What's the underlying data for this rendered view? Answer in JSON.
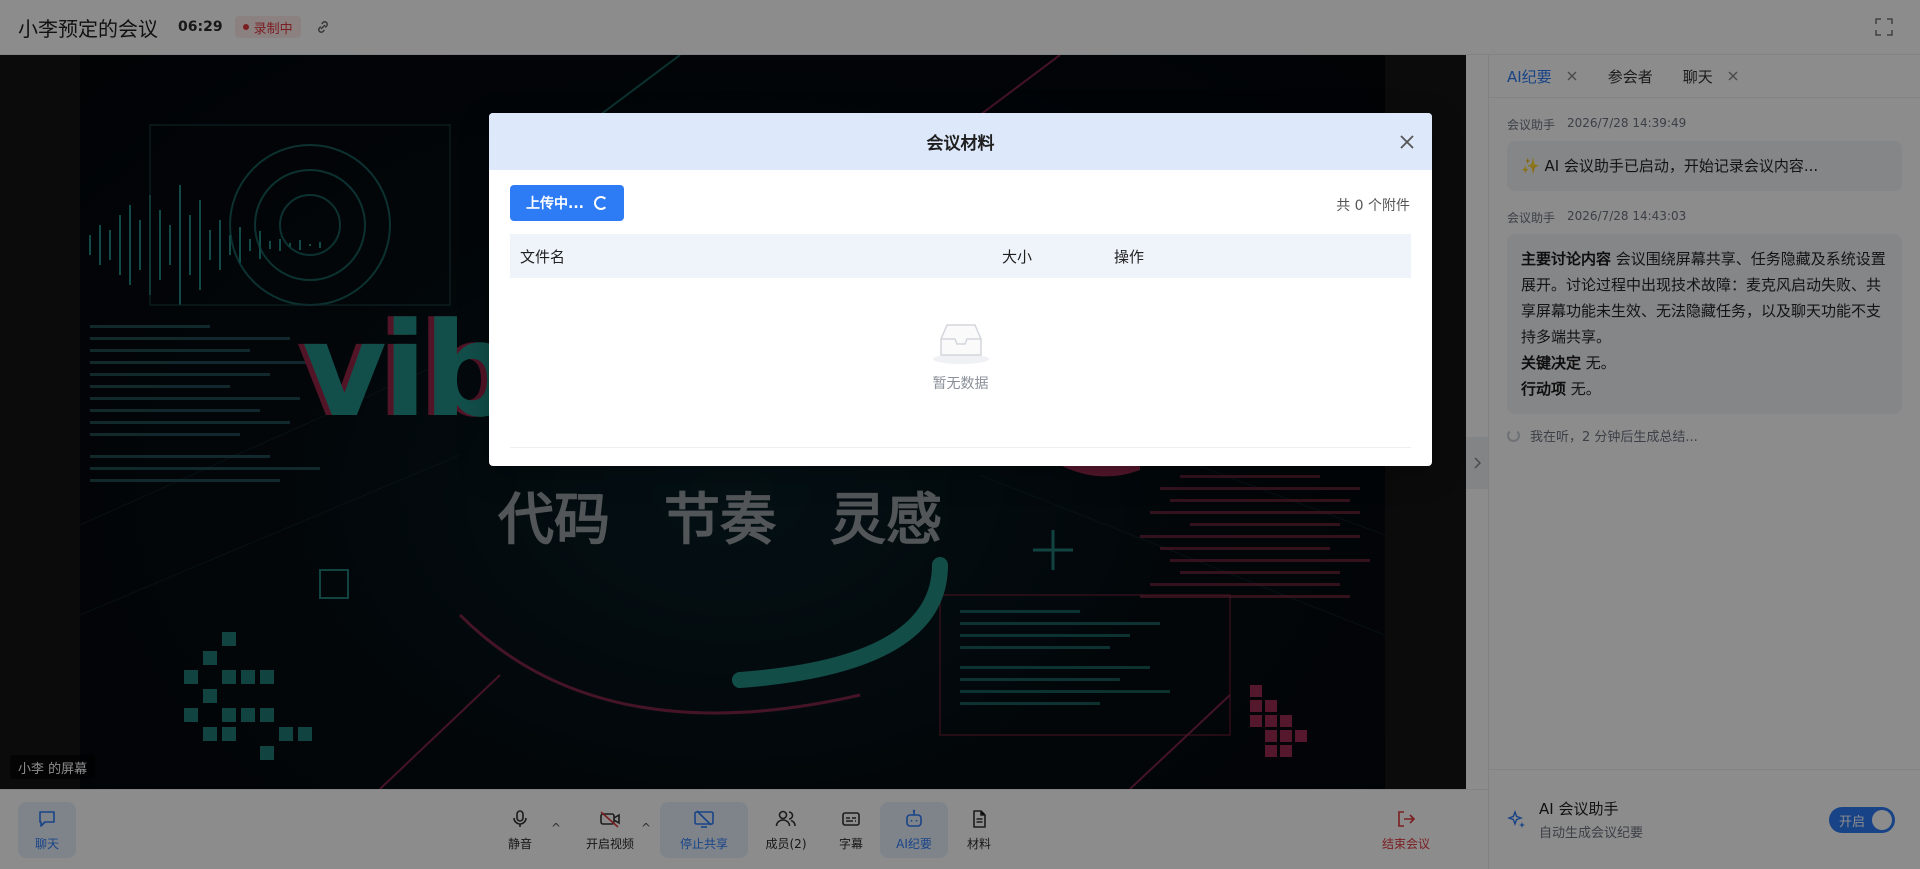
{
  "header": {
    "title": "小李预定的会议",
    "timer": "06:29",
    "recording": "录制中"
  },
  "stage": {
    "share_label": "小李 的屏幕",
    "content_big_text": "vib",
    "content_slogan": [
      "代码",
      "节奏",
      "灵感"
    ]
  },
  "panel": {
    "tabs": [
      {
        "label": "AI纪要",
        "active": true,
        "closable": true
      },
      {
        "label": "参会者",
        "active": false,
        "closable": false
      },
      {
        "label": "聊天",
        "active": false,
        "closable": true
      }
    ],
    "messages": [
      {
        "sender": "会议助手",
        "time": "2026/7/28 14:39:49",
        "text": "✨ AI 会议助手已启动，开始记录会议内容..."
      },
      {
        "sender": "会议助手",
        "time": "2026/7/28 14:43:03",
        "sections": [
          {
            "label": "主要讨论内容",
            "text": " 会议围绕屏幕共享、任务隐藏及系统设置展开。讨论过程中出现技术故障：麦克风启动失败、共享屏幕功能未生效、无法隐藏任务，以及聊天功能不支持多端共享。"
          },
          {
            "label": "关键决定",
            "text": " 无。"
          },
          {
            "label": "行动项",
            "text": " 无。"
          }
        ]
      }
    ],
    "listening_text": "我在听，2 分钟后生成总结...",
    "assistant": {
      "title": "AI 会议助手",
      "subtitle": "自动生成会议纪要",
      "toggle_label": "开启"
    }
  },
  "toolbar": {
    "chat": "聊天",
    "mute": "静音",
    "video": "开启视频",
    "stop_share": "停止共享",
    "members": "成员(2)",
    "captions": "字幕",
    "ai_minutes": "AI纪要",
    "materials": "材料",
    "end": "结束会议"
  },
  "modal": {
    "title": "会议材料",
    "upload_label": "上传中...",
    "count_text": "共 0 个附件",
    "columns": {
      "name": "文件名",
      "size": "大小",
      "op": "操作"
    },
    "empty_text": "暂无数据"
  },
  "colors": {
    "accent": "#2d7cf6",
    "danger": "#e0383e",
    "modal_header": "#dde9fb"
  }
}
